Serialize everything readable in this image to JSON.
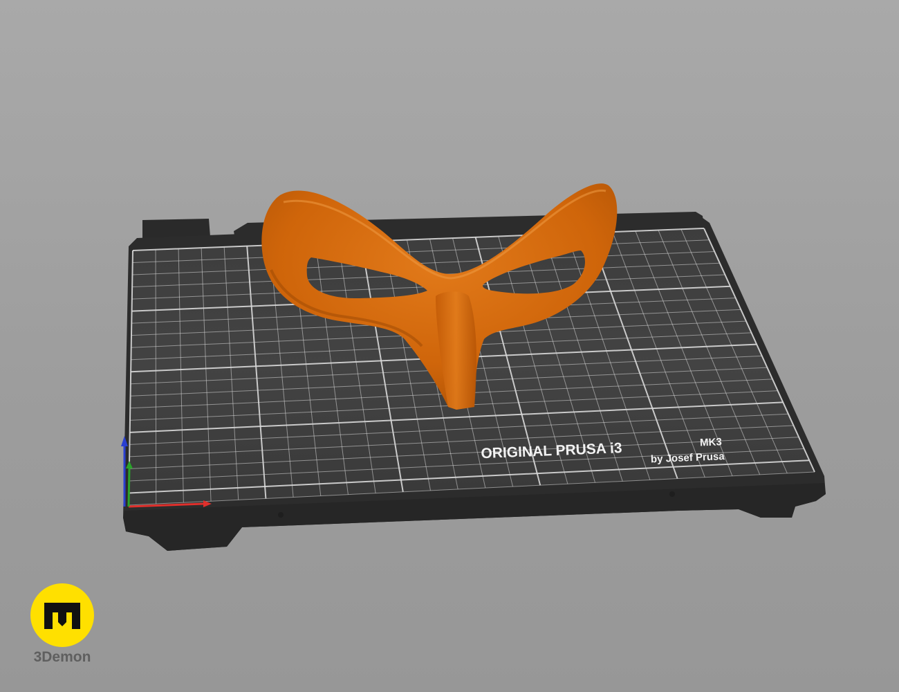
{
  "scene": {
    "background_color": "#a3a3a3",
    "bed": {
      "brand_line": "ORIGINAL PRUSA i3",
      "model_line": "MK3",
      "byline": "by Josef Prusa",
      "surface_color": "#3a3a3a",
      "frame_color": "#2b2b2b",
      "grid_color": "#d9d9d9"
    },
    "model": {
      "name": "mask",
      "color": "#d4680b"
    },
    "axes": {
      "x_color": "#e0302c",
      "y_color": "#2aa32a",
      "z_color": "#2a3fd1"
    }
  },
  "brand": {
    "name": "3Demon",
    "logo_icon": "3demon-logo-icon",
    "logo_color": "#ffe000"
  }
}
